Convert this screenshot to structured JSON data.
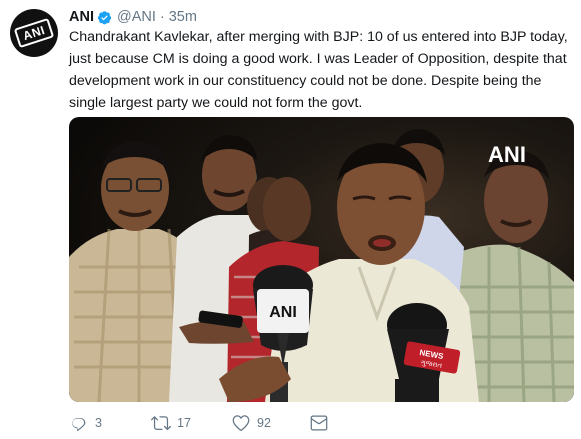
{
  "tweet": {
    "author_name": "ANI",
    "author_handle": "@ANI",
    "separator": "·",
    "time": "35m",
    "text": "Chandrakant Kavlekar, after merging with BJP: 10 of us entered into BJP today, just because CM is doing a good work. I was Leader of Opposition, despite that development work in our constituency could not be done. Despite being the single largest party we could not form the govt.",
    "avatar_logo": "ANI",
    "verified_color": "#1da1f2"
  },
  "media": {
    "watermark": "ANI",
    "mic_logo": "ANI",
    "news_mic_label": "NEWS",
    "news_mic_sublabel": "ગુજરાત"
  },
  "actions": {
    "replies": "3",
    "retweets": "17",
    "likes": "92",
    "icons": [
      "reply-icon",
      "retweet-icon",
      "like-icon",
      "direct-message-icon"
    ]
  }
}
